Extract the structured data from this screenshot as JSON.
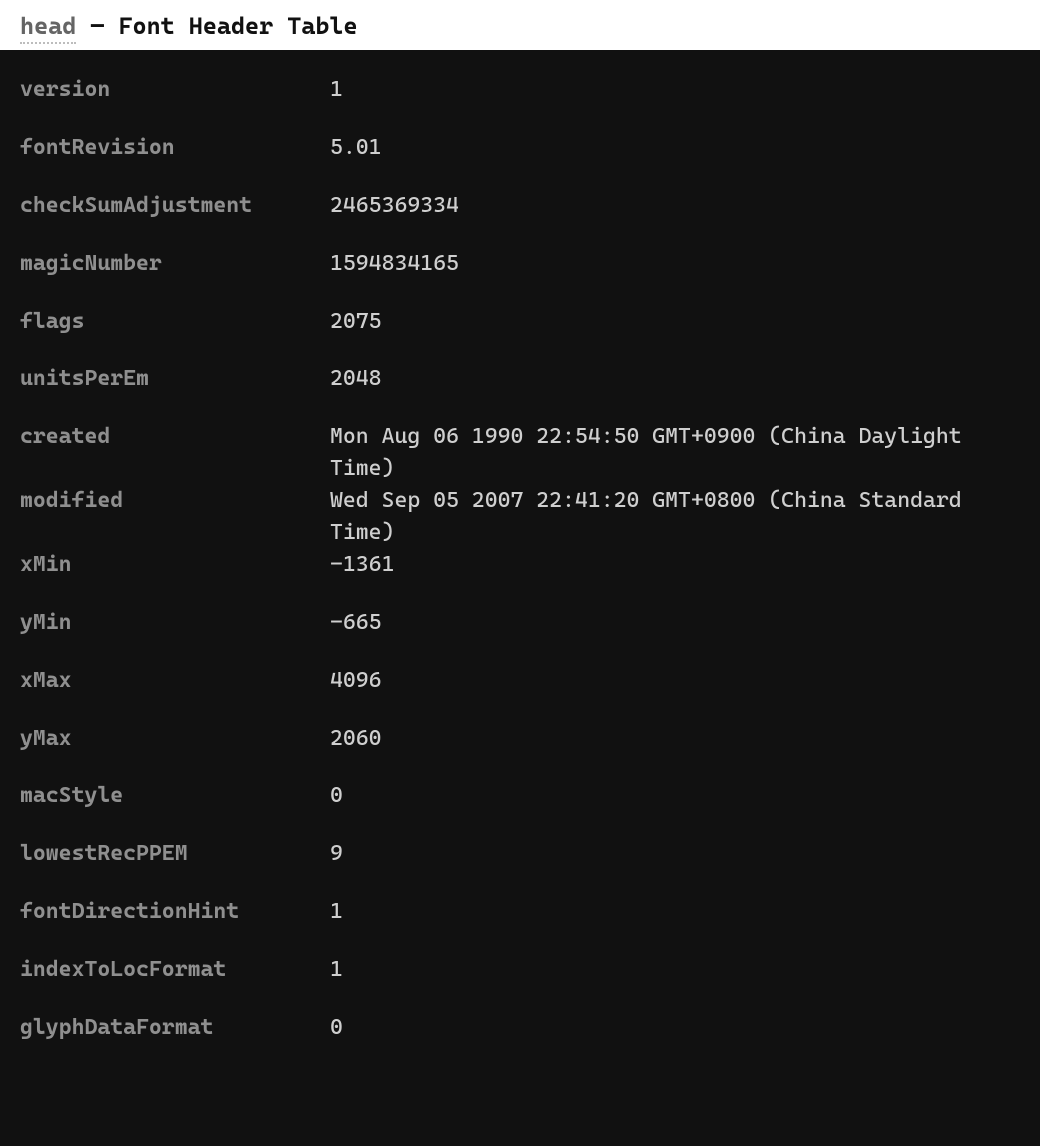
{
  "header": {
    "tag": "head",
    "separator": "—",
    "title": "Font Header Table"
  },
  "rows": [
    {
      "key": "version",
      "value": "1"
    },
    {
      "key": "fontRevision",
      "value": "5.01"
    },
    {
      "key": "checkSumAdjustment",
      "value": "2465369334"
    },
    {
      "key": "magicNumber",
      "value": "1594834165"
    },
    {
      "key": "flags",
      "value": "2075"
    },
    {
      "key": "unitsPerEm",
      "value": "2048"
    },
    {
      "key": "created",
      "value": "Mon Aug 06 1990 22:54:50 GMT+0900 (China Daylight Time)"
    },
    {
      "key": "modified",
      "value": "Wed Sep 05 2007 22:41:20 GMT+0800 (China Standard Time)",
      "tight": true
    },
    {
      "key": "xMin",
      "value": "-1361",
      "tight": true
    },
    {
      "key": "yMin",
      "value": "-665"
    },
    {
      "key": "xMax",
      "value": "4096"
    },
    {
      "key": "yMax",
      "value": "2060"
    },
    {
      "key": "macStyle",
      "value": "0"
    },
    {
      "key": "lowestRecPPEM",
      "value": "9"
    },
    {
      "key": "fontDirectionHint",
      "value": "1"
    },
    {
      "key": "indexToLocFormat",
      "value": "1"
    },
    {
      "key": "glyphDataFormat",
      "value": "0"
    }
  ]
}
